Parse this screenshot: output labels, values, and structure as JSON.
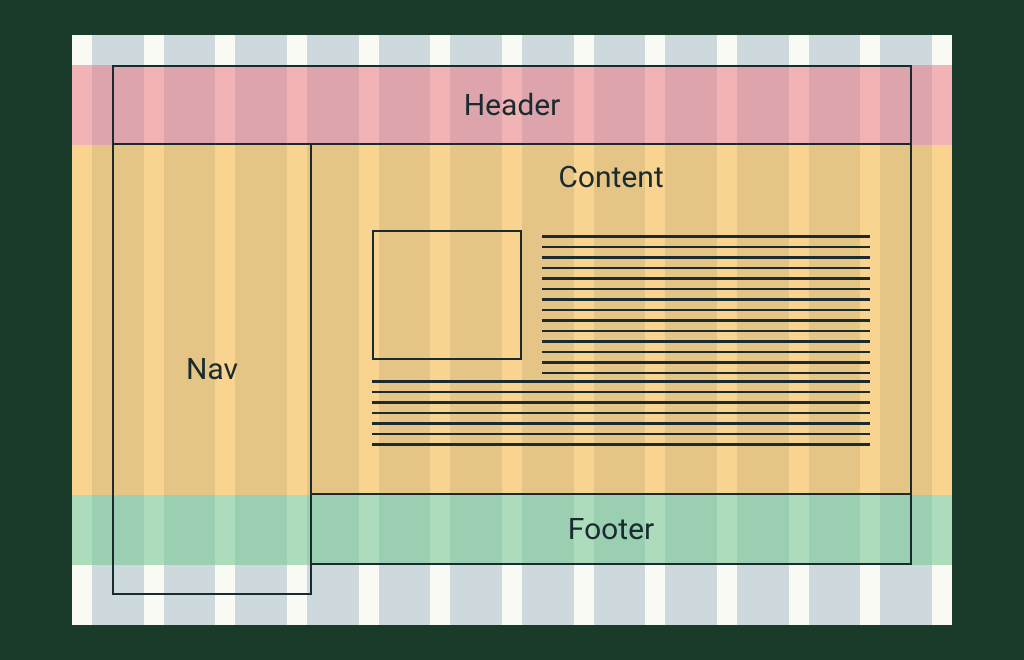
{
  "layout": {
    "header_label": "Header",
    "nav_label": "Nav",
    "content_label": "Content",
    "footer_label": "Footer"
  },
  "grid": {
    "columns": 12
  },
  "colors": {
    "header_band": "#e8a0a8",
    "body_band": "#f0c068",
    "footer_band": "#90d0a8",
    "column": "#cdd9dd",
    "page_bg": "#fafaf5",
    "outer_bg": "#1a3a2a",
    "stroke": "#1a2b2f"
  }
}
